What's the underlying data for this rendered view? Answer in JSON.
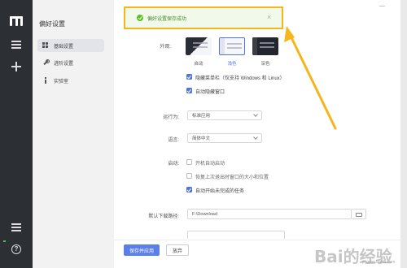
{
  "nav": {
    "title": "偏好设置",
    "items": [
      {
        "label": "基础设置",
        "icon": "grid-icon",
        "active": true
      },
      {
        "label": "进阶设置",
        "icon": "wrench-icon",
        "active": false
      },
      {
        "label": "实验室",
        "icon": "info-icon",
        "active": false
      }
    ]
  },
  "toast": {
    "message": "偏好设置保存成功",
    "close": "×"
  },
  "window": {
    "minimize": "—"
  },
  "appearance": {
    "label": "外观:",
    "options": [
      {
        "label": "自动",
        "selected": false
      },
      {
        "label": "浅色",
        "selected": true
      },
      {
        "label": "深色",
        "selected": false
      }
    ],
    "hide_menubar": "隐藏菜单栏（仅支持 Windows 和 Linux）",
    "auto_hide_window": "自动隐藏窗口"
  },
  "run_as": {
    "label": "运行为:",
    "value": "标准应用"
  },
  "language": {
    "label": "语言:",
    "value": "简体中文"
  },
  "startup": {
    "label": "启动:",
    "options": [
      {
        "label": "开机自动启动",
        "checked": false
      },
      {
        "label": "恢复上次退出时窗口的大小和位置",
        "checked": false
      },
      {
        "label": "自动开始未完成的任务",
        "checked": true
      }
    ]
  },
  "download": {
    "label": "默认下载路径:",
    "path": "F:\\Download"
  },
  "footer": {
    "save": "保存并应用",
    "cancel": "放弃"
  },
  "watermark": {
    "brand": "Bai的经验",
    "sub": "jingyan.baidu.com"
  },
  "colors": {
    "accent": "#5b7fe8",
    "toast_border": "#f5b51b",
    "success": "#52c41a",
    "rail": "#2c2f33"
  }
}
